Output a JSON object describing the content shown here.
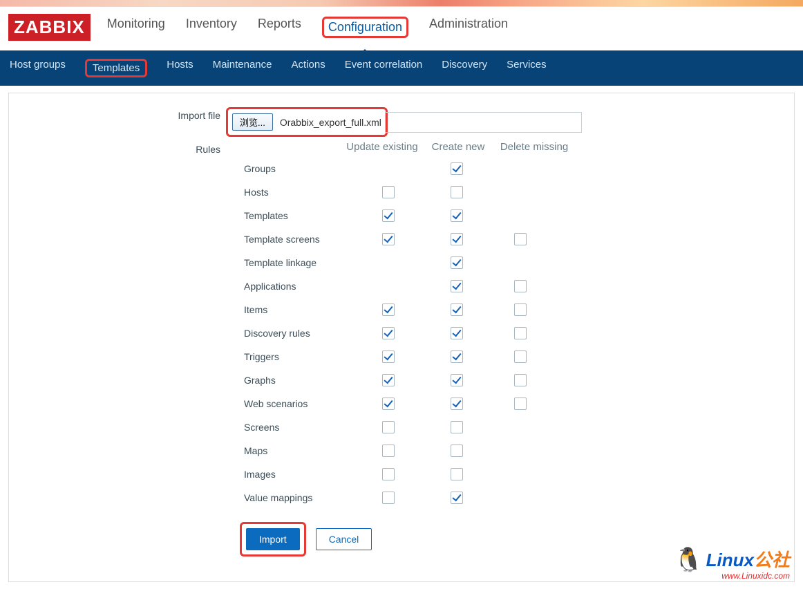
{
  "logo": "ZABBIX",
  "main_nav": {
    "items": [
      "Monitoring",
      "Inventory",
      "Reports",
      "Configuration",
      "Administration"
    ],
    "active_index": 3
  },
  "sub_nav": {
    "items": [
      "Host groups",
      "Templates",
      "Hosts",
      "Maintenance",
      "Actions",
      "Event correlation",
      "Discovery",
      "Services"
    ],
    "highlighted_index": 1
  },
  "form": {
    "import_file_label": "Import file",
    "browse_button": "浏览...",
    "file_name": "Orabbix_export_full.xml",
    "rules_label": "Rules",
    "headers": {
      "update_existing": "Update existing",
      "create_new": "Create new",
      "delete_missing": "Delete missing"
    },
    "rules": [
      {
        "name": "Groups",
        "ue": null,
        "cn": true,
        "dm": null
      },
      {
        "name": "Hosts",
        "ue": false,
        "cn": false,
        "dm": null
      },
      {
        "name": "Templates",
        "ue": true,
        "cn": true,
        "dm": null
      },
      {
        "name": "Template screens",
        "ue": true,
        "cn": true,
        "dm": false
      },
      {
        "name": "Template linkage",
        "ue": null,
        "cn": true,
        "dm": null
      },
      {
        "name": "Applications",
        "ue": null,
        "cn": true,
        "dm": false
      },
      {
        "name": "Items",
        "ue": true,
        "cn": true,
        "dm": false
      },
      {
        "name": "Discovery rules",
        "ue": true,
        "cn": true,
        "dm": false
      },
      {
        "name": "Triggers",
        "ue": true,
        "cn": true,
        "dm": false
      },
      {
        "name": "Graphs",
        "ue": true,
        "cn": true,
        "dm": false
      },
      {
        "name": "Web scenarios",
        "ue": true,
        "cn": true,
        "dm": false
      },
      {
        "name": "Screens",
        "ue": false,
        "cn": false,
        "dm": null
      },
      {
        "name": "Maps",
        "ue": false,
        "cn": false,
        "dm": null
      },
      {
        "name": "Images",
        "ue": false,
        "cn": false,
        "dm": null
      },
      {
        "name": "Value mappings",
        "ue": false,
        "cn": true,
        "dm": null
      }
    ],
    "import_button": "Import",
    "cancel_button": "Cancel"
  },
  "watermark": {
    "brand_main": "Linux",
    "brand_suffix": "公社",
    "url": "www.Linuxidc.com"
  }
}
